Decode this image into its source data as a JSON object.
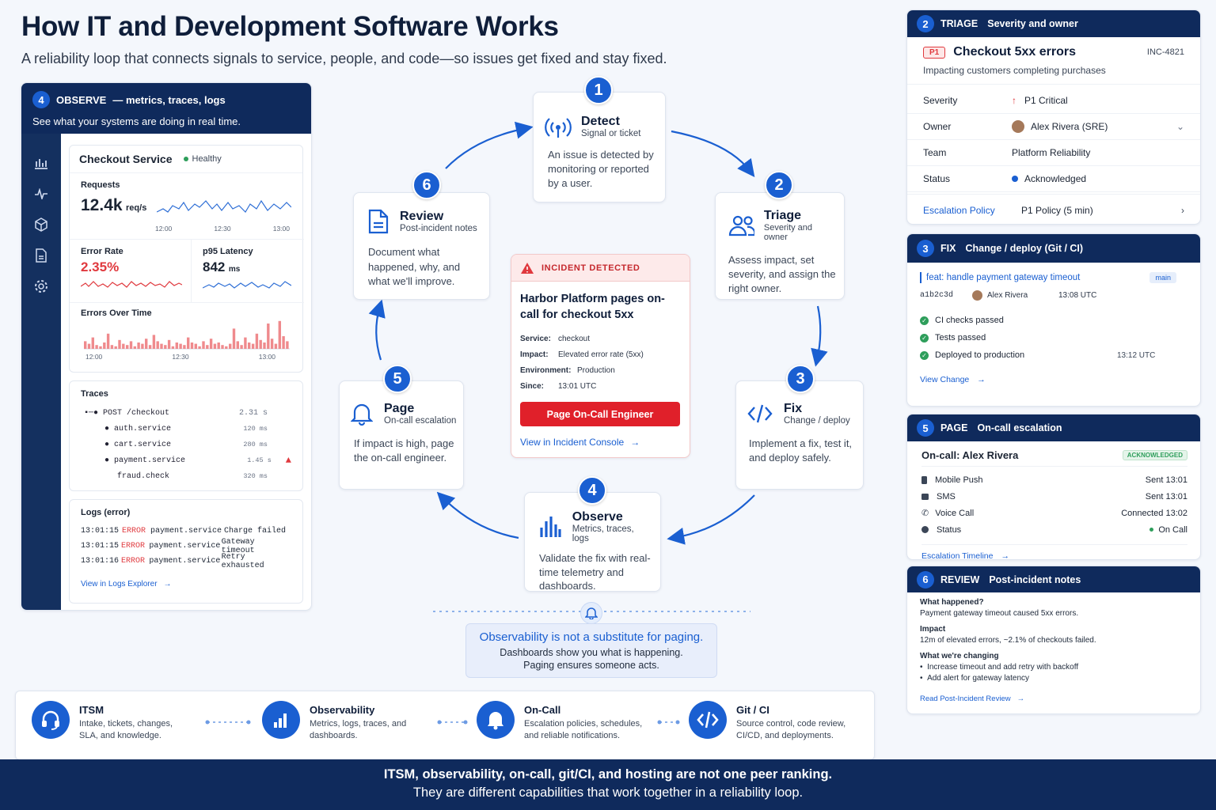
{
  "header": {
    "title": "How IT and Development Software Works",
    "subtitle": "A reliability loop that connects signals to service, people, and code—so issues get fixed and stay fixed."
  },
  "observe_panel": {
    "badge": "4",
    "heading": "OBSERVE",
    "heading_rest": "— metrics, traces, logs",
    "tagline": "See what your systems are doing in real time.",
    "service_name": "Checkout Service",
    "service_status": "Healthy",
    "requests_label": "Requests",
    "requests_value": "12.4k",
    "requests_unit": "req/s",
    "requests_ticks": [
      "12:00",
      "12:30",
      "13:00"
    ],
    "error_rate_label": "Error Rate",
    "error_rate_value": "2.35%",
    "latency_label": "p95 Latency",
    "latency_value": "842",
    "latency_unit": "ms",
    "errors_over_time_label": "Errors Over Time",
    "errors_ticks": [
      "12:00",
      "12:30",
      "13:00"
    ],
    "traces_label": "Traces",
    "traces": [
      {
        "name": "POST /checkout",
        "dur": "2.31 s"
      },
      {
        "name": "auth.service",
        "dur": "120 ms"
      },
      {
        "name": "cart.service",
        "dur": "280 ms"
      },
      {
        "name": "payment.service",
        "dur": "1.45 s"
      },
      {
        "name": "fraud.check",
        "dur": "320 ms"
      }
    ],
    "logs_label": "Logs (error)",
    "logs": [
      {
        "time": "13:01:15",
        "level": "ERROR",
        "svc": "payment.service",
        "msg": "Charge failed"
      },
      {
        "time": "13:01:15",
        "level": "ERROR",
        "svc": "payment.service",
        "msg": "Gateway timeout"
      },
      {
        "time": "13:01:16",
        "level": "ERROR",
        "svc": "payment.service",
        "msg": "Retry exhausted"
      }
    ],
    "logs_link": "View in Logs Explorer"
  },
  "steps": [
    {
      "num": "1",
      "title": "Detect",
      "sub": "Signal or ticket",
      "desc": "An issue is detected by monitoring or reported by a user."
    },
    {
      "num": "2",
      "title": "Triage",
      "sub": "Severity and owner",
      "desc": "Assess impact, set severity, and assign the right owner."
    },
    {
      "num": "3",
      "title": "Fix",
      "sub": "Change / deploy",
      "desc": "Implement a fix, test it, and deploy safely."
    },
    {
      "num": "4",
      "title": "Observe",
      "sub": "Metrics, traces, logs",
      "desc": "Validate the fix with real-time telemetry and dashboards."
    },
    {
      "num": "5",
      "title": "Page",
      "sub": "On-call escalation",
      "desc": "If impact is high, page the on-call engineer."
    },
    {
      "num": "6",
      "title": "Review",
      "sub": "Post-incident notes",
      "desc": "Document what happened, why, and what we'll improve."
    }
  ],
  "incident": {
    "banner": "INCIDENT DETECTED",
    "title": "Harbor Platform pages on-call for checkout 5xx",
    "fields": [
      {
        "k": "Service:",
        "v": "checkout"
      },
      {
        "k": "Impact:",
        "v": "Elevated error rate (5xx)"
      },
      {
        "k": "Environment:",
        "v": "Production"
      },
      {
        "k": "Since:",
        "v": "13:01 UTC"
      }
    ],
    "button": "Page On-Call Engineer",
    "link": "View in Incident Console"
  },
  "note": {
    "title": "Observability is not a substitute for paging.",
    "line1": "Dashboards show you what is happening.",
    "line2": "Paging ensures someone acts."
  },
  "triage_panel": {
    "badge": "2",
    "heading": "TRIAGE",
    "heading_rest": "Severity and owner",
    "priority": "P1",
    "title": "Checkout 5xx errors",
    "ticket": "INC-4821",
    "impact": "Impacting customers completing purchases",
    "rows": [
      {
        "k": "Severity",
        "v": "P1 Critical"
      },
      {
        "k": "Owner",
        "v": "Alex Rivera (SRE)"
      },
      {
        "k": "Team",
        "v": "Platform Reliability"
      },
      {
        "k": "Status",
        "v": "Acknowledged"
      }
    ],
    "policy_label": "Escalation Policy",
    "policy_value": "P1 Policy (5 min)"
  },
  "fix_panel": {
    "badge": "3",
    "heading": "FIX",
    "heading_rest": "Change / deploy (Git / CI)",
    "commit_msg": "feat: handle payment gateway timeout",
    "branch": "main",
    "sha": "a1b2c3d",
    "author": "Alex Rivera",
    "time": "13:08 UTC",
    "checks": [
      {
        "label": "CI checks passed",
        "time": ""
      },
      {
        "label": "Tests passed",
        "time": ""
      },
      {
        "label": "Deployed to production",
        "time": "13:12 UTC"
      }
    ],
    "link": "View Change"
  },
  "page_panel": {
    "badge": "5",
    "heading": "PAGE",
    "heading_rest": "On-call escalation",
    "oncall": "On-call: Alex Rivera",
    "ack": "ACKNOWLEDGED",
    "channels": [
      {
        "k": "Mobile Push",
        "v": "Sent 13:01"
      },
      {
        "k": "SMS",
        "v": "Sent 13:01"
      },
      {
        "k": "Voice Call",
        "v": "Connected 13:02"
      },
      {
        "k": "Status",
        "v": "On Call"
      }
    ],
    "link": "Escalation Timeline"
  },
  "review_panel": {
    "badge": "6",
    "heading": "REVIEW",
    "heading_rest": "Post-incident notes",
    "q1": "What happened?",
    "a1": "Payment gateway timeout caused 5xx errors.",
    "q2": "Impact",
    "a2": "12m of elevated errors, ~2.1% of checkouts failed.",
    "q3": "What we're changing",
    "bullets": [
      "Increase timeout and add retry with backoff",
      "Add alert for gateway latency"
    ],
    "link": "Read Post-Incident Review"
  },
  "capabilities": [
    {
      "title": "ITSM",
      "desc": "Intake, tickets, changes, SLA, and knowledge.",
      "icon": "headset-icon"
    },
    {
      "title": "Observability",
      "desc": "Metrics, logs, traces, and dashboards.",
      "icon": "bar-chart-icon"
    },
    {
      "title": "On-Call",
      "desc": "Escalation policies, schedules, and reliable notifications.",
      "icon": "bell-icon"
    },
    {
      "title": "Git / CI",
      "desc": "Source control, code review, CI/CD, and deployments.",
      "icon": "code-icon"
    }
  ],
  "footer": {
    "line1": "ITSM, observability, on-call, git/CI, and hosting are not one peer ranking.",
    "line2": "They are different capabilities that work together in a reliability loop."
  },
  "colors": {
    "navy": "#0f2a5c",
    "accent": "#1a5fd1",
    "error": "#e0393e",
    "success": "#2e9e5b"
  }
}
